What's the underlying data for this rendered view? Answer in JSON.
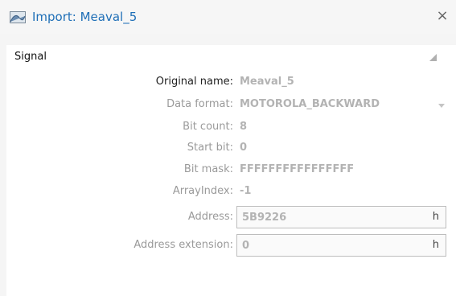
{
  "window": {
    "title": "Import: Meaval_5",
    "icon": "signal-wave-icon",
    "close": "×"
  },
  "section": {
    "title": "Signal",
    "collapse_icon": "collapse-triangle-icon"
  },
  "fields": {
    "original_name": {
      "label": "Original name:",
      "value": "Meaval_5"
    },
    "data_format": {
      "label": "Data format:",
      "value": "MOTOROLA_BACKWARD"
    },
    "bit_count": {
      "label": "Bit count:",
      "value": "8"
    },
    "start_bit": {
      "label": "Start bit:",
      "value": "0"
    },
    "bit_mask": {
      "label": "Bit mask:",
      "value": "FFFFFFFFFFFFFFFF"
    },
    "array_index": {
      "label": "ArrayIndex:",
      "value": "-1"
    },
    "address": {
      "label": "Address:",
      "value": "5B9226",
      "suffix": "h"
    },
    "address_extension": {
      "label": "Address extension:",
      "value": "0",
      "suffix": "h"
    }
  },
  "colors": {
    "title_text": "#1f6fb7",
    "disabled_text": "#b3b3b3",
    "panel_bg": "#ffffff",
    "window_bg": "#f5f5f5"
  }
}
